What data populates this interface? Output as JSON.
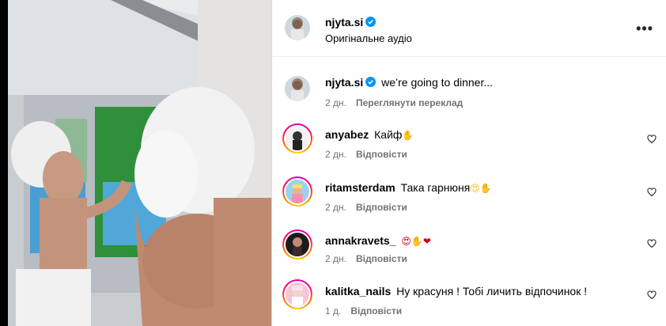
{
  "post": {
    "author": "njyta.si",
    "audio": "Оригінальне аудіо",
    "more_icon": "more-horizontal-icon"
  },
  "caption": {
    "username": "njyta.si",
    "text": "we’re going to dinner...",
    "age": "2 дн.",
    "translate": "Переглянути переклад"
  },
  "comments": [
    {
      "username": "anyabez",
      "text": "Кайф",
      "emoji": "✋",
      "age": "2 дн.",
      "reply": "Відповісти"
    },
    {
      "username": "ritamsterdam",
      "text": "Така гарнюня",
      "emoji": "😍✋",
      "age": "2 дн.",
      "reply": "Відповісти"
    },
    {
      "username": "annakravets_",
      "text": "",
      "emoji": "😍✋❤",
      "age": "2 дн.",
      "reply": "Відповісти"
    },
    {
      "username": "kalitka_nails",
      "text": "Ну красуня ! Тобі личить відпочинок !",
      "emoji": "",
      "age": "1 д.",
      "reply": "Відповісти"
    }
  ],
  "colors": {
    "verified": "#0095f6",
    "meta": "#737373",
    "heart": "#262626",
    "emoji_heart": "#d0021b",
    "emoji_hand": "#f5c518"
  }
}
